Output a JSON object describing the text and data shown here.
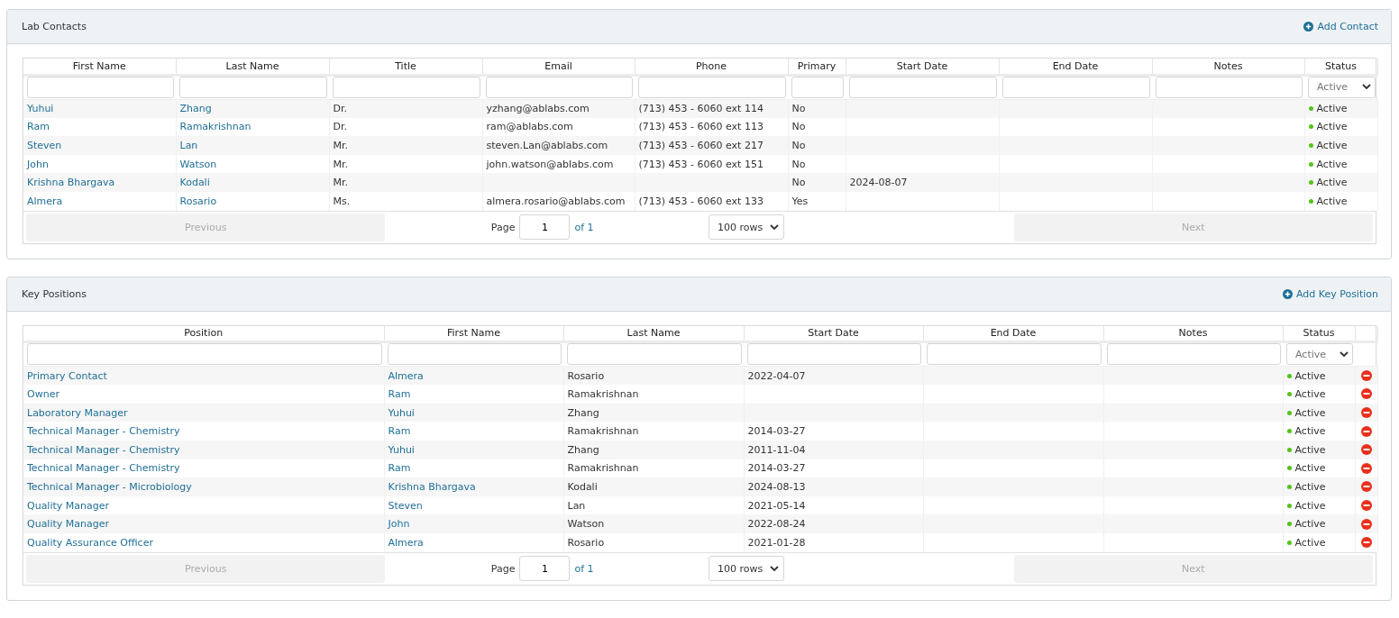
{
  "panels": [
    {
      "title": "Lab Contacts",
      "action": "Add Contact",
      "row_delete": false,
      "columns": [
        {
          "label": "First Name",
          "kind": "link"
        },
        {
          "label": "Last Name",
          "kind": "link"
        },
        {
          "label": "Title",
          "kind": "text"
        },
        {
          "label": "Email",
          "kind": "text"
        },
        {
          "label": "Phone",
          "kind": "text"
        },
        {
          "label": "Primary",
          "kind": "text"
        },
        {
          "label": "Start Date",
          "kind": "text"
        },
        {
          "label": "End Date",
          "kind": "text"
        },
        {
          "label": "Notes",
          "kind": "text"
        },
        {
          "label": "Status",
          "kind": "status",
          "filter_value": "Active"
        }
      ],
      "rows": [
        [
          "Yuhui",
          "Zhang",
          "Dr.",
          "yzhang@ablabs.com",
          "(713) 453 - 6060 ext 114",
          "No",
          null,
          null,
          null,
          "Active"
        ],
        [
          "Ram",
          "Ramakrishnan",
          "Dr.",
          "ram@ablabs.com",
          "(713) 453 - 6060 ext 113",
          "No",
          null,
          null,
          null,
          "Active"
        ],
        [
          "Steven",
          "Lan",
          "Mr.",
          "steven.Lan@ablabs.com",
          "(713) 453 - 6060 ext 217",
          "No",
          null,
          null,
          null,
          "Active"
        ],
        [
          "John",
          "Watson",
          "Mr.",
          "john.watson@ablabs.com",
          "(713) 453 - 6060 ext 151",
          "No",
          null,
          null,
          null,
          "Active"
        ],
        [
          "Krishna Bhargava",
          "Kodali",
          "Mr.",
          null,
          null,
          "No",
          "2024-08-07",
          null,
          null,
          "Active"
        ],
        [
          "Almera",
          "Rosario",
          "Ms.",
          "almera.rosario@ablabs.com",
          "(713) 453 - 6060 ext 133",
          "Yes",
          null,
          null,
          null,
          "Active"
        ]
      ],
      "pager": {
        "previous": "Previous",
        "previous_disabled": true,
        "page_label": "Page",
        "page": "1",
        "of": "of 1",
        "rows": "100 rows",
        "next": "Next",
        "next_disabled": true
      }
    },
    {
      "title": "Key Positions",
      "action": "Add Key Position",
      "row_delete": true,
      "columns": [
        {
          "label": "Position",
          "kind": "link"
        },
        {
          "label": "First Name",
          "kind": "link"
        },
        {
          "label": "Last Name",
          "kind": "text"
        },
        {
          "label": "Start Date",
          "kind": "text"
        },
        {
          "label": "End Date",
          "kind": "text"
        },
        {
          "label": "Notes",
          "kind": "text"
        },
        {
          "label": "Status",
          "kind": "status",
          "filter_value": "Active"
        }
      ],
      "rows": [
        [
          "Primary Contact",
          "Almera",
          "Rosario",
          "2022-04-07",
          null,
          null,
          "Active"
        ],
        [
          "Owner",
          "Ram",
          "Ramakrishnan",
          null,
          null,
          null,
          "Active"
        ],
        [
          "Laboratory Manager",
          "Yuhui",
          "Zhang",
          null,
          null,
          null,
          "Active"
        ],
        [
          "Technical Manager - Chemistry",
          "Ram",
          "Ramakrishnan",
          "2014-03-27",
          null,
          null,
          "Active"
        ],
        [
          "Technical Manager - Chemistry",
          "Yuhui",
          "Zhang",
          "2011-11-04",
          null,
          null,
          "Active"
        ],
        [
          "Technical Manager - Chemistry",
          "Ram",
          "Ramakrishnan",
          "2014-03-27",
          null,
          null,
          "Active"
        ],
        [
          "Technical Manager - Microbiology",
          "Krishna Bhargava",
          "Kodali",
          "2024-08-13",
          null,
          null,
          "Active"
        ],
        [
          "Quality Manager",
          "Steven",
          "Lan",
          "2021-05-14",
          null,
          null,
          "Active"
        ],
        [
          "Quality Manager",
          "John",
          "Watson",
          "2022-08-24",
          null,
          null,
          "Active"
        ],
        [
          "Quality Assurance Officer",
          "Almera",
          "Rosario",
          "2021-01-28",
          null,
          null,
          "Active"
        ]
      ],
      "pager": {
        "previous": "Previous",
        "previous_disabled": true,
        "page_label": "Page",
        "page": "1",
        "of": "of 1",
        "rows": "100 rows",
        "next": "Next",
        "next_disabled": true
      }
    }
  ]
}
